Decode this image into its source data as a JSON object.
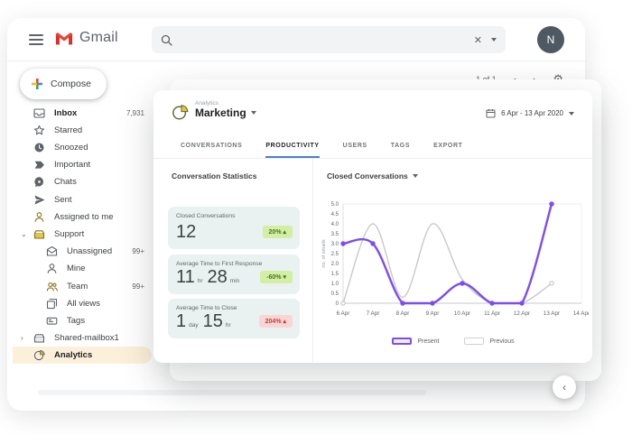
{
  "glyphs": {
    "close": "✕",
    "gear": "⚙",
    "chev_left": "‹",
    "chev_right": "›",
    "twisty_open": "⌄",
    "twisty_closed": "›",
    "fab_chevron": "‹"
  },
  "gmail": {
    "brand": "Gmail",
    "avatar_letter": "N",
    "compose_label": "Compose",
    "pagination": "1 of 1",
    "sidebar": [
      {
        "label": "Inbox",
        "count": "7,931"
      },
      {
        "label": "Starred"
      },
      {
        "label": "Snoozed"
      },
      {
        "label": "Important"
      },
      {
        "label": "Chats"
      },
      {
        "label": "Sent"
      },
      {
        "label": "Assigned to me"
      },
      {
        "label": "Support"
      },
      {
        "label": "Unassigned",
        "count": "99+"
      },
      {
        "label": "Mine"
      },
      {
        "label": "Team",
        "count": "99+"
      },
      {
        "label": "All views"
      },
      {
        "label": "Tags"
      },
      {
        "label": "Shared-mailbox1"
      },
      {
        "label": "Analytics"
      }
    ]
  },
  "panel": {
    "app_label": "Analytics",
    "view_name": "Marketing",
    "date_range": "6 Apr  -  13 Apr 2020",
    "tabs": [
      "CONVERSATIONS",
      "PRODUCTIVITY",
      "USERS",
      "TAGS",
      "EXPORT"
    ],
    "active_tab": "PRODUCTIVITY",
    "stats_heading": "Conversation Statistics",
    "cards": [
      {
        "label": "Closed Conversations",
        "v1": "12",
        "badge": "20% ▴",
        "badge_type": "good"
      },
      {
        "label": "Average Time to First Response",
        "v1": "11",
        "u1": "hr",
        "v2": "28",
        "u2": "min",
        "badge": "-60% ▾",
        "badge_type": "good"
      },
      {
        "label": "Average Time to Close",
        "v1": "1",
        "u1": "day",
        "v2": "15",
        "u2": "hr",
        "badge": "204% ▴",
        "badge_type": "bad"
      }
    ],
    "chart_title": "Closed Conversations"
  },
  "chart_data": {
    "type": "line",
    "title": "Closed Conversations",
    "x": [
      "6 Apr",
      "7 Apr",
      "8 Apr",
      "9 Apr",
      "10 Apr",
      "11 Apr",
      "12 Apr",
      "13 Apr",
      "14 Apr"
    ],
    "ylabel": "no. of emails",
    "ylim": [
      0,
      5
    ],
    "yticks": [
      0,
      0.5,
      1.0,
      1.5,
      2.0,
      2.5,
      3.0,
      3.5,
      4.0,
      4.5,
      5.0
    ],
    "grid": false,
    "legend_position": "bottom",
    "series": [
      {
        "name": "Present",
        "color": "#7c4df2",
        "values": [
          3,
          3,
          0,
          0,
          1,
          0,
          0,
          5,
          null
        ]
      },
      {
        "name": "Previous",
        "color": "#c9c9c9",
        "values": [
          0,
          4,
          0.3,
          4,
          1.2,
          0,
          0,
          1,
          null
        ]
      }
    ]
  }
}
